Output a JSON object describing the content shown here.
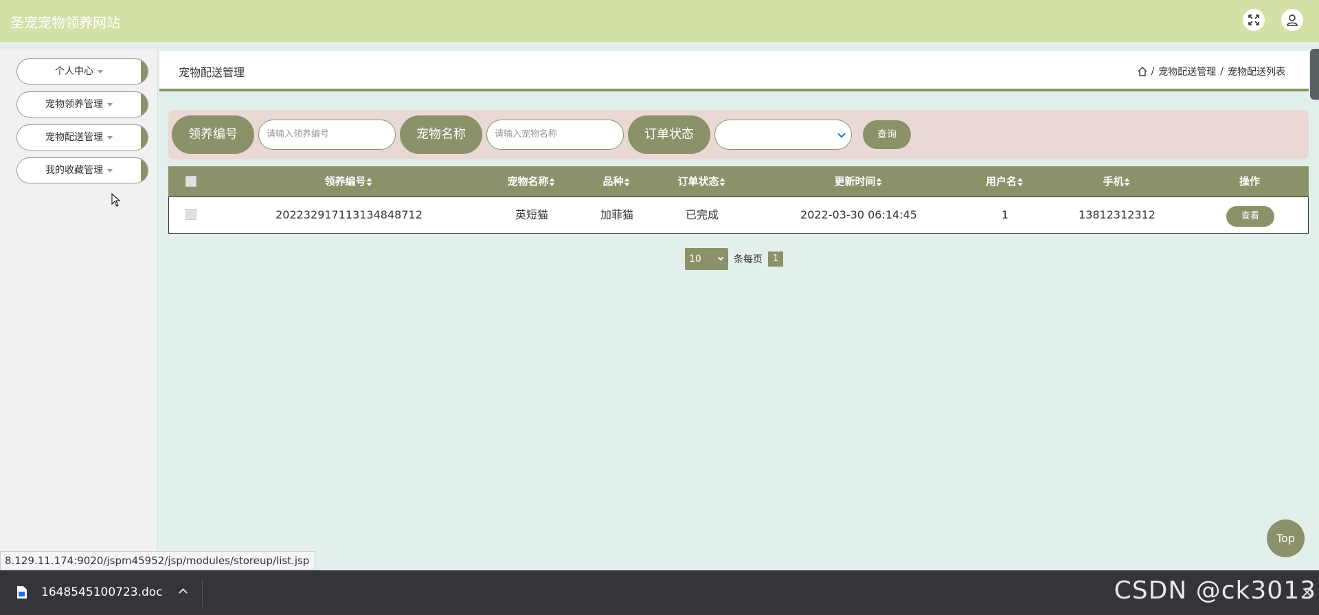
{
  "app": {
    "title": "圣宠宠物领养网站"
  },
  "sidebar": {
    "items": [
      {
        "label": "个人中心"
      },
      {
        "label": "宠物领养管理"
      },
      {
        "label": "宠物配送管理"
      },
      {
        "label": "我的收藏管理"
      }
    ]
  },
  "header": {
    "title": "宠物配送管理",
    "breadcrumb": [
      "宠物配送管理",
      "宠物配送列表"
    ],
    "separator": "/"
  },
  "search": {
    "field1_label": "领养编号",
    "field1_placeholder": "请输入领养编号",
    "field2_label": "宠物名称",
    "field2_placeholder": "请输入宠物名称",
    "field3_label": "订单状态",
    "field3_value": "",
    "query_label": "查询"
  },
  "table": {
    "columns": [
      "领养编号",
      "宠物名称",
      "品种",
      "订单状态",
      "更新时间",
      "用户名",
      "手机",
      "操作"
    ],
    "rows": [
      {
        "adopt_no": "20223291711313484871​2",
        "pet_name": "英短猫",
        "breed": "加菲猫",
        "status": "已完成",
        "updated": "2022-03-30 06:14:45",
        "username": "1",
        "phone": "13812312312",
        "action": "查看"
      }
    ]
  },
  "pagination": {
    "page_size": "10",
    "per_page_label": "条每页",
    "current_page": "1"
  },
  "top_button": "Top",
  "status_bar": {
    "url": "8.129.11.174:9020/jspm45952/jsp/modules/storeup/list.jsp"
  },
  "download_bar": {
    "filename": "1648545100723.doc",
    "watermark": "CSDN @ck3013"
  },
  "colors": {
    "topbar": "#d3e0a6",
    "accent": "#8b9169",
    "search_bg": "#e9d8d4",
    "page_bg": "#e3efea"
  }
}
